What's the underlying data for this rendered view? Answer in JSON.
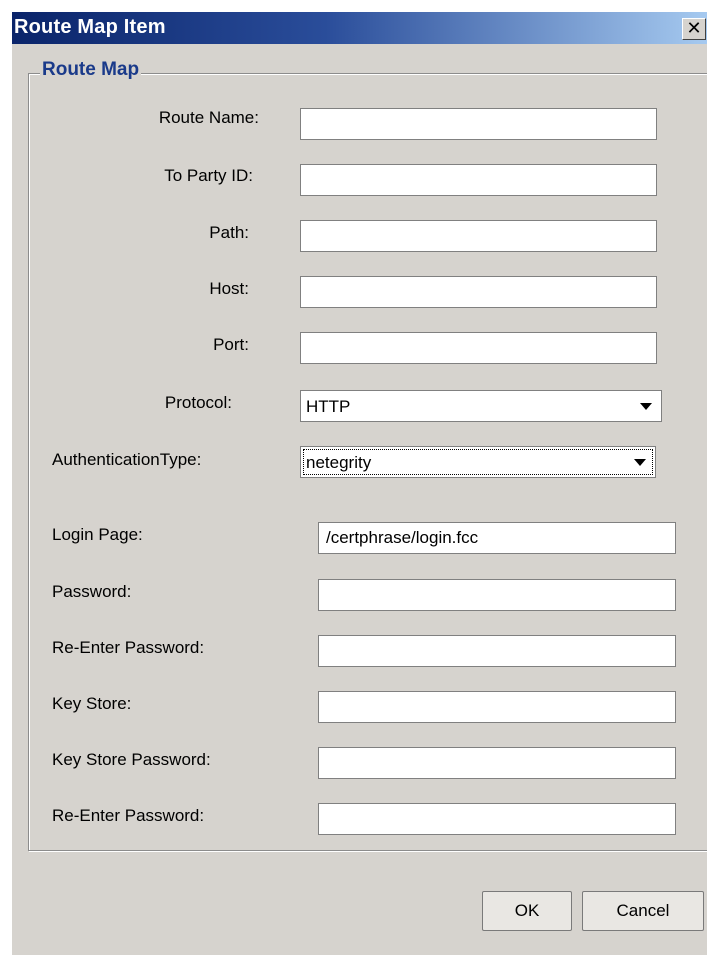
{
  "window": {
    "title": "Route Map Item",
    "close_glyph": "✕",
    "close_icon": "close-icon"
  },
  "group": {
    "title": "Route Map"
  },
  "fields": {
    "route_name": {
      "label": "Route Name:",
      "value": ""
    },
    "to_party_id": {
      "label": "To Party ID:",
      "value": ""
    },
    "path": {
      "label": "Path:",
      "value": ""
    },
    "host": {
      "label": "Host:",
      "value": ""
    },
    "port": {
      "label": "Port:",
      "value": ""
    },
    "protocol": {
      "label": "Protocol:",
      "value": "HTTP"
    },
    "auth_type": {
      "label": "AuthenticationType:",
      "value": "netegrity"
    },
    "login_page": {
      "label": "Login Page:",
      "value": "/certphrase/login.fcc"
    },
    "password": {
      "label": "Password:",
      "value": ""
    },
    "reenter_password": {
      "label": "Re-Enter Password:",
      "value": ""
    },
    "key_store": {
      "label": "Key Store:",
      "value": ""
    },
    "key_store_password": {
      "label": "Key Store Password:",
      "value": ""
    },
    "reenter_key_store_password": {
      "label": "Re-Enter Password:",
      "value": ""
    }
  },
  "buttons": {
    "ok": "OK",
    "cancel": "Cancel"
  },
  "colors": {
    "title_start": "#0a246a",
    "title_end": "#a6caf0",
    "dialog_bg": "#d6d3ce",
    "group_title": "#1a3a8a"
  }
}
